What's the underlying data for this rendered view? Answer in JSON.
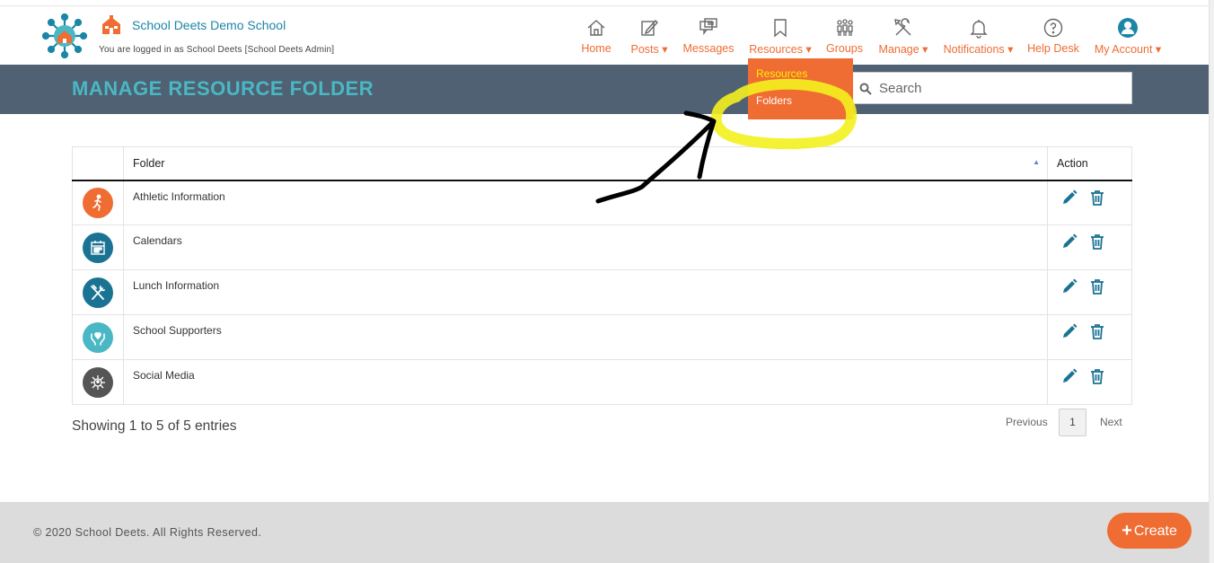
{
  "header": {
    "school_name": "School Deets Demo School",
    "login_text": "You are logged in as School Deets [School Deets Admin]"
  },
  "nav": [
    {
      "label": "Home",
      "icon": "home-icon"
    },
    {
      "label": "Posts ▾",
      "icon": "edit-icon"
    },
    {
      "label": "Messages",
      "icon": "chat-icon"
    },
    {
      "label": "Resources ▾",
      "icon": "bookmark-icon"
    },
    {
      "label": "Groups",
      "icon": "people-icon"
    },
    {
      "label": "Manage ▾",
      "icon": "tools-icon"
    },
    {
      "label": "Notifications ▾",
      "icon": "bell-icon"
    },
    {
      "label": "Help Desk",
      "icon": "question-icon"
    },
    {
      "label": "My Account ▾",
      "icon": "user-icon"
    }
  ],
  "dropdown": {
    "items": [
      "Resources",
      "Folders"
    ]
  },
  "banner": {
    "title": "MANAGE RESOURCE FOLDER",
    "search_placeholder": "Search"
  },
  "table": {
    "columns": [
      "",
      "Folder",
      "Action"
    ],
    "rows": [
      {
        "name": "Athletic Information",
        "icon": "runner-icon",
        "color": "#ef6c33"
      },
      {
        "name": "Calendars",
        "icon": "calendar-icon",
        "color": "#1b7394"
      },
      {
        "name": "Lunch Information",
        "icon": "utensils-icon",
        "color": "#1b7394"
      },
      {
        "name": "School Supporters",
        "icon": "hands-heart-icon",
        "color": "#4ab8c4"
      },
      {
        "name": "Social Media",
        "icon": "network-icon",
        "color": "#555555"
      }
    ]
  },
  "pagination": {
    "summary": "Showing 1 to 5 of 5 entries",
    "previous": "Previous",
    "current_page": "1",
    "next": "Next"
  },
  "footer": {
    "copyright": "© 2020 School Deets. All Rights Reserved.",
    "create_label": "Create"
  },
  "colors": {
    "accent": "#ef6c33",
    "banner": "#4f6173",
    "title": "#4ab8c4",
    "brand_blue": "#1b86a6"
  }
}
